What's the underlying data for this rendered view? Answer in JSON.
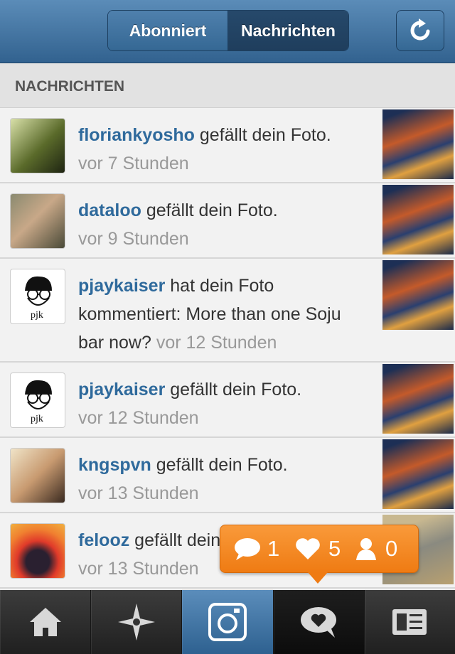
{
  "header": {
    "tabs": [
      "Abonniert",
      "Nachrichten"
    ],
    "active_tab": "Nachrichten",
    "refresh_icon": "refresh-icon"
  },
  "section": {
    "title": "NACHRICHTEN"
  },
  "notifications": [
    {
      "user": "floriankyosho",
      "action": "gefällt dein Foto.",
      "time": "vor 7 Stunden",
      "avatar": "avatar-photo"
    },
    {
      "user": "dataloo",
      "action": "gefällt dein Foto.",
      "time": "vor 9 Stunden",
      "avatar": "avatar-photo"
    },
    {
      "user": "pjaykaiser",
      "action": "hat dein Foto kommentiert: More than one Soju bar now?",
      "time": "vor 12 Stunden",
      "avatar": "avatar-pjk"
    },
    {
      "user": "pjaykaiser",
      "action": "gefällt dein Foto.",
      "time": "vor 12 Stunden",
      "avatar": "avatar-pjk"
    },
    {
      "user": "kngspvn",
      "action": "gefällt dein Foto.",
      "time": "vor 13 Stunden",
      "avatar": "avatar-photo"
    },
    {
      "user": "felooz",
      "action": "gefällt dein Foto.",
      "time": "vor 13 Stunden",
      "avatar": "avatar-photo"
    }
  ],
  "popup": {
    "comments": "1",
    "likes": "5",
    "followers": "0"
  },
  "tabbar": [
    "home-icon",
    "explore-icon",
    "camera-icon",
    "news-icon",
    "profile-icon"
  ],
  "colors": {
    "accent": "#2f6a9c",
    "popup": "#f58a24",
    "header": "#3f709e"
  }
}
